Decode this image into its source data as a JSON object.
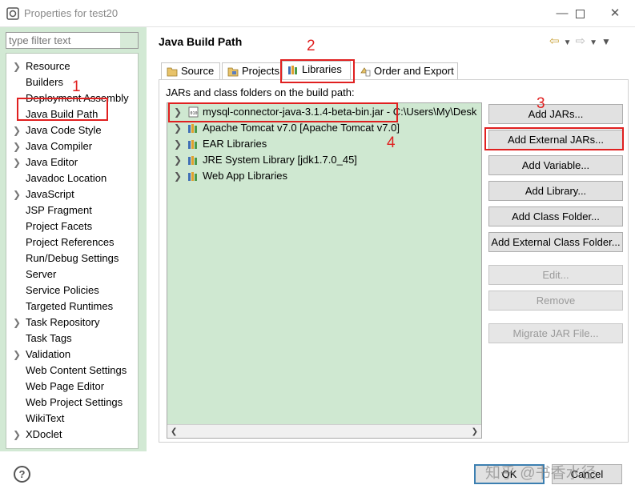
{
  "window": {
    "title": "Properties for test20"
  },
  "filter": {
    "placeholder": "type filter text"
  },
  "tree": [
    {
      "label": "Resource",
      "expandable": true
    },
    {
      "label": "Builders",
      "expandable": false
    },
    {
      "label": "Deployment Assembly",
      "expandable": false
    },
    {
      "label": "Java Build Path",
      "expandable": false,
      "selected": true
    },
    {
      "label": "Java Code Style",
      "expandable": true
    },
    {
      "label": "Java Compiler",
      "expandable": true
    },
    {
      "label": "Java Editor",
      "expandable": true
    },
    {
      "label": "Javadoc Location",
      "expandable": false
    },
    {
      "label": "JavaScript",
      "expandable": true
    },
    {
      "label": "JSP Fragment",
      "expandable": false
    },
    {
      "label": "Project Facets",
      "expandable": false
    },
    {
      "label": "Project References",
      "expandable": false
    },
    {
      "label": "Run/Debug Settings",
      "expandable": false
    },
    {
      "label": "Server",
      "expandable": false
    },
    {
      "label": "Service Policies",
      "expandable": false
    },
    {
      "label": "Targeted Runtimes",
      "expandable": false
    },
    {
      "label": "Task Repository",
      "expandable": true
    },
    {
      "label": "Task Tags",
      "expandable": false
    },
    {
      "label": "Validation",
      "expandable": true
    },
    {
      "label": "Web Content Settings",
      "expandable": false
    },
    {
      "label": "Web Page Editor",
      "expandable": false
    },
    {
      "label": "Web Project Settings",
      "expandable": false
    },
    {
      "label": "WikiText",
      "expandable": false
    },
    {
      "label": "XDoclet",
      "expandable": true
    }
  ],
  "page": {
    "title": "Java Build Path"
  },
  "tabs": [
    {
      "label": "Source",
      "icon": "source-folder-icon"
    },
    {
      "label": "Projects",
      "icon": "projects-icon"
    },
    {
      "label": "Libraries",
      "icon": "libraries-icon",
      "active": true
    },
    {
      "label": "Order and Export",
      "icon": "order-export-icon"
    }
  ],
  "libraries": {
    "label": "JARs and class folders on the build path:",
    "items": [
      {
        "label": "mysql-connector-java-3.1.4-beta-bin.jar - C:\\Users\\My\\Desk",
        "icon": "jar-icon"
      },
      {
        "label": "Apache Tomcat v7.0 [Apache Tomcat v7.0]",
        "icon": "library-icon"
      },
      {
        "label": "EAR Libraries",
        "icon": "library-icon"
      },
      {
        "label": "JRE System Library [jdk1.7.0_45]",
        "icon": "library-icon"
      },
      {
        "label": "Web App Libraries",
        "icon": "library-icon"
      }
    ]
  },
  "buttons": {
    "add_jars": "Add JARs...",
    "add_external_jars": "Add External JARs...",
    "add_variable": "Add Variable...",
    "add_library": "Add Library...",
    "add_class_folder": "Add Class Folder...",
    "add_external_class_folder": "Add External Class Folder...",
    "edit": "Edit...",
    "remove": "Remove",
    "migrate_jar": "Migrate JAR File..."
  },
  "dialog": {
    "help": "?",
    "ok": "OK",
    "cancel": "Cancel"
  },
  "annotations": [
    "1",
    "2",
    "3",
    "4"
  ],
  "watermark": "知乎 @书香水径",
  "colors": {
    "panel_green": "#d2e9d4",
    "list_green": "#cfe8d1",
    "annotation_red": "#e02020",
    "focus_blue": "#3c7fb1"
  }
}
